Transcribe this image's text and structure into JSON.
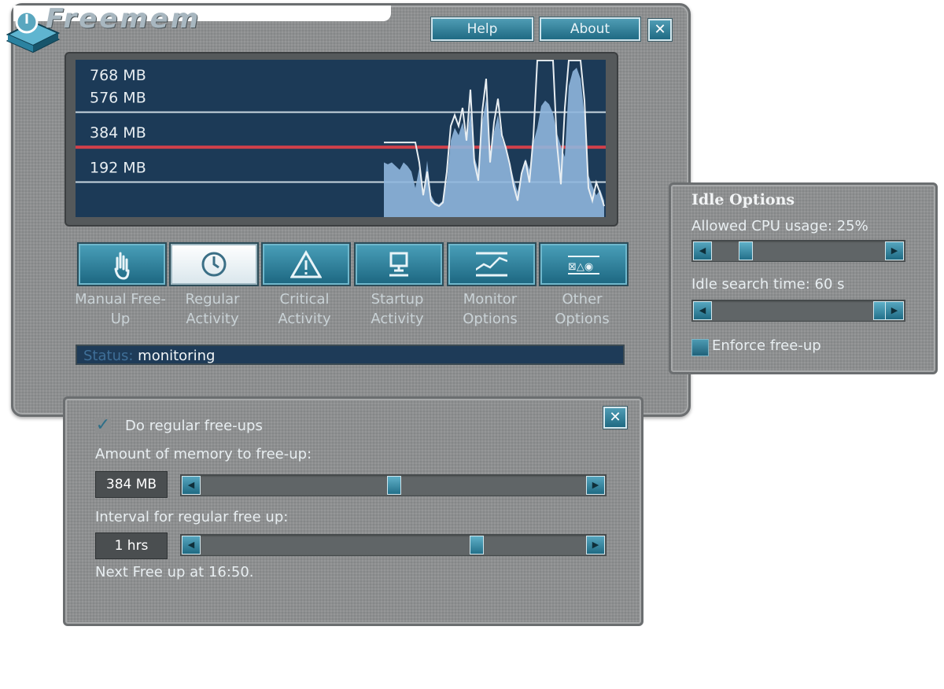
{
  "app": {
    "title": "Freemem",
    "help_label": "Help",
    "about_label": "About",
    "close_label": "✕"
  },
  "chart": {
    "gridlines": [
      "768 MB",
      "576 MB",
      "384 MB",
      "192 MB"
    ]
  },
  "chart_data": {
    "type": "area",
    "title": "",
    "xlabel": "",
    "ylabel": "",
    "ylim": [
      0,
      864
    ],
    "y_ticks": [
      "768 MB",
      "576 MB",
      "384 MB",
      "192 MB"
    ],
    "threshold": 384,
    "threshold_color": "#d0404a",
    "series": [
      {
        "type": "area",
        "color": "#8fb6dd",
        "values": [
          300,
          290,
          300,
          280,
          260,
          300,
          280,
          250,
          160,
          270,
          120,
          310,
          120,
          80,
          70,
          90,
          200,
          420,
          490,
          450,
          520,
          420,
          580,
          330,
          260,
          520,
          650,
          320,
          470,
          560,
          430,
          370,
          300,
          210,
          140,
          250,
          320,
          260,
          410,
          490,
          610,
          640,
          620,
          570,
          460,
          390,
          330,
          720,
          800,
          820,
          760,
          560,
          230,
          170,
          120,
          150,
          90
        ]
      },
      {
        "type": "line",
        "color": "#e8eef2",
        "values": [
          410,
          410,
          410,
          410,
          410,
          410,
          410,
          410,
          410,
          300,
          120,
          250,
          90,
          70,
          60,
          80,
          250,
          500,
          560,
          500,
          600,
          420,
          700,
          300,
          200,
          580,
          760,
          300,
          520,
          650,
          450,
          380,
          290,
          170,
          90,
          240,
          310,
          190,
          440,
          860,
          860,
          860,
          860,
          860,
          400,
          180,
          600,
          860,
          860,
          860,
          860,
          640,
          160,
          90,
          190,
          130,
          60
        ]
      }
    ]
  },
  "actions": [
    {
      "label": "Manual Free-Up",
      "icon": "hand-icon",
      "selected": false
    },
    {
      "label": "Regular Activity",
      "icon": "clock-icon",
      "selected": true
    },
    {
      "label": "Critical Activity",
      "icon": "warning-icon",
      "selected": false
    },
    {
      "label": "Startup Activity",
      "icon": "computer-icon",
      "selected": false
    },
    {
      "label": "Monitor Options",
      "icon": "graph-icon",
      "selected": false
    },
    {
      "label": "Other Options",
      "icon": "options-icon",
      "selected": false
    }
  ],
  "status": {
    "key": "Status:",
    "value": "monitoring"
  },
  "idle": {
    "title": "Idle Options",
    "cpu_label": "Allowed CPU usage: 25%",
    "cpu_value": 0.25,
    "search_label": "Idle search time: 60 s",
    "search_value": 1.0,
    "enforce_label": "Enforce free-up",
    "enforce_checked": false
  },
  "regular": {
    "do_label": "Do regular free-ups",
    "do_checked": true,
    "checkmark": "✓",
    "amount_label": "Amount of memory to free-up:",
    "amount_value": "384 MB",
    "amount_fraction": 0.5,
    "interval_label": "Interval for regular free up:",
    "interval_value": "1 hrs",
    "interval_fraction": 0.72,
    "next_label": "Next Free up at 16:50."
  },
  "colors": {
    "accent": "#2a7d99",
    "chart_bg": "#1c3a57",
    "threshold": "#d0404a",
    "window": "#8d8f90"
  }
}
